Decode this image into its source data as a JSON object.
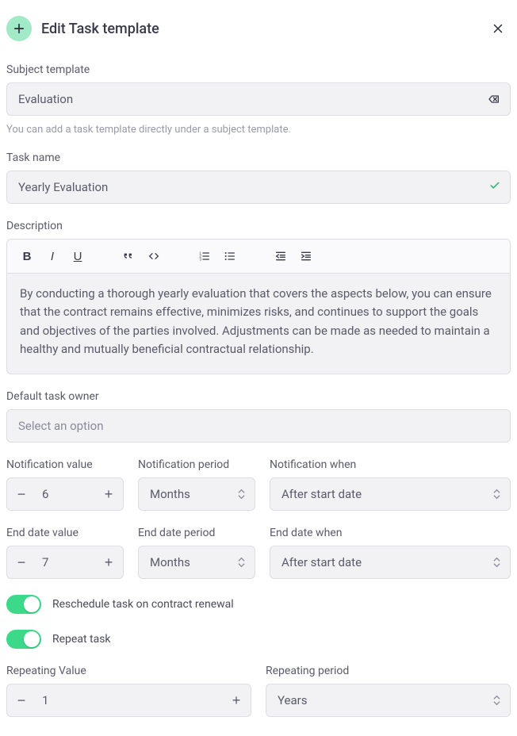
{
  "header": {
    "title": "Edit Task template"
  },
  "subject_template": {
    "label": "Subject template",
    "value": "Evaluation",
    "help": "You can add a task template directly under a subject template."
  },
  "task_name": {
    "label": "Task name",
    "value": "Yearly Evaluation"
  },
  "description": {
    "label": "Description",
    "body": "By conducting a thorough yearly evaluation that covers the aspects below, you can ensure that the contract remains effective, minimizes risks, and continues to support the goals and objectives of the parties involved. Adjustments can be made as needed to maintain a healthy and mutually beneficial contractual relationship."
  },
  "default_task_owner": {
    "label": "Default task owner",
    "placeholder": "Select an option"
  },
  "notification": {
    "value_label": "Notification value",
    "value": "6",
    "period_label": "Notification period",
    "period": "Months",
    "when_label": "Notification when",
    "when": "After start date"
  },
  "end_date": {
    "value_label": "End date value",
    "value": "7",
    "period_label": "End date period",
    "period": "Months",
    "when_label": "End date when",
    "when": "After start date"
  },
  "toggles": {
    "reschedule_label": "Reschedule task on contract renewal",
    "repeat_label": "Repeat task"
  },
  "repeating": {
    "value_label": "Repeating Value",
    "value": "1",
    "period_label": "Repeating period",
    "period": "Years"
  }
}
